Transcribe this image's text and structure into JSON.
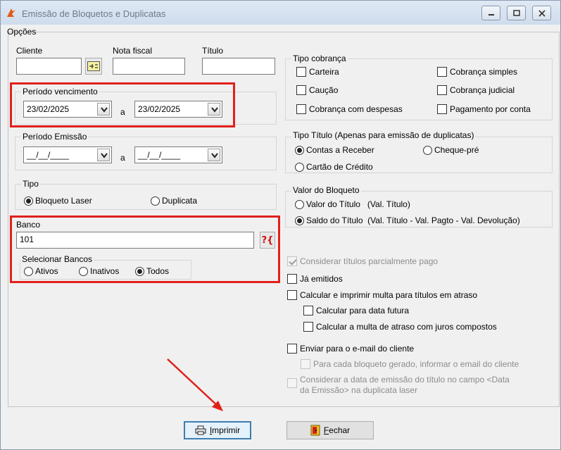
{
  "window": {
    "title": "Emissão de Bloquetos e Duplicatas"
  },
  "opcoes_label": "Opções",
  "cliente": {
    "label": "Cliente",
    "value": ""
  },
  "nota_fiscal": {
    "label": "Nota fiscal",
    "value": ""
  },
  "titulo": {
    "label": "Título",
    "value": ""
  },
  "periodo_vencimento": {
    "label": "Período vencimento",
    "from": "23/02/2025",
    "sep": "a",
    "to": "23/02/2025"
  },
  "periodo_emissao": {
    "label": "Período Emissão",
    "from": "__/__/____",
    "sep": "a",
    "to": "__/__/____"
  },
  "tipo": {
    "label": "Tipo",
    "options": [
      "Bloqueto Laser",
      "Duplicata"
    ],
    "selected": "Bloqueto Laser"
  },
  "banco": {
    "label": "Banco",
    "value": "101",
    "lookup_icon_text": "?{",
    "selecionar_label": "Selecionar Bancos",
    "options": [
      "Ativos",
      "Inativos",
      "Todos"
    ],
    "selected": "Todos"
  },
  "tipo_cobranca": {
    "label": "Tipo cobrança",
    "options": [
      "Carteira",
      "Cobrança simples",
      "Caução",
      "Cobrança judicial",
      "Cobrança com despesas",
      "Pagamento por conta"
    ]
  },
  "tipo_titulo": {
    "label": "Tipo Título (Apenas para emissão de duplicatas)",
    "options": [
      "Contas a Receber",
      "Cheque-pré",
      "Cartão de Crédito"
    ],
    "selected": "Contas a Receber"
  },
  "valor_bloqueto": {
    "label": "Valor do Bloqueto",
    "options": [
      "Valor do Título   (Val. Título)",
      "Saldo do Título  (Val. Título - Val. Pagto - Val. Devolução)"
    ],
    "selected": "Saldo do Título  (Val. Título - Val. Pagto - Val. Devolução)"
  },
  "checks": {
    "considerar_parcial": "Considerar títulos parcialmente pago",
    "ja_emitidos": "Já emitidos",
    "calcular_multa": "Calcular e imprimir multa para títulos em atraso",
    "data_futura": "Calcular para data futura",
    "juros_compostos": "Calcular a multa de atraso com juros compostos",
    "enviar_email": "Enviar para o e-mail do cliente",
    "cada_bloqueto": "Para cada bloqueto gerado, informar o email do cliente",
    "considerar_data_line1": "Considerar a data de emissão do título no campo <Data",
    "considerar_data_line2": "da Emissão> na duplicata laser"
  },
  "buttons": {
    "imprimir_u": "I",
    "imprimir_rest": "mprimir",
    "fechar_u": "F",
    "fechar_rest": "echar"
  },
  "colors": {
    "highlight": "#e0201b",
    "arrow": "#e0201b"
  }
}
